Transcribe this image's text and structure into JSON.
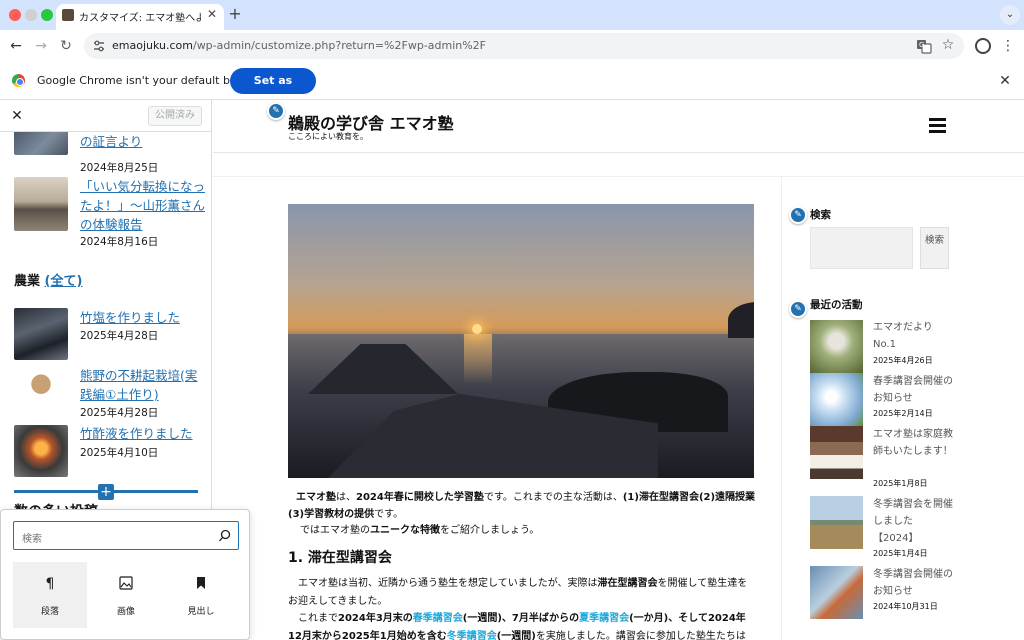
{
  "browser": {
    "tab_title": "カスタマイズ: エマオ塾へようこそ",
    "tab_close": "✕",
    "new_tab": "+",
    "tab_menu": "⌄",
    "url_host": "emaojuku.com",
    "url_path": "/wp-admin/customize.php?return=%2Fwp-admin%2F",
    "nav_back": "←",
    "nav_forward": "→",
    "nav_reload": "↻",
    "star": "☆",
    "kebab": "⋮"
  },
  "infobar": {
    "message": "Google Chrome isn't your default browser",
    "button_label": "Set as default",
    "close": "✕"
  },
  "customizer": {
    "close": "✕",
    "published_label": "公開済み",
    "posts_top": [
      {
        "title": "て！」〜福本航子さんの証言より",
        "title_visible": "て！」〜福本航子さ\nんの証言より",
        "date": "2024年8月25日"
      },
      {
        "title": "「いい気分転換になったよ！」〜山形薫さんの体験報告",
        "date": "2024年8月16日"
      }
    ],
    "category": {
      "name": "農業",
      "all_link": "(全て)"
    },
    "posts_agri": [
      {
        "title": "竹塩を作りました",
        "date": "2025年4月28日"
      },
      {
        "title": "熊野の不耕起栽培(実践編①土作り)",
        "date": "2025年4月28日"
      },
      {
        "title": "竹酢液を作りました",
        "date": "2025年4月10日"
      }
    ],
    "peek_heading": "数の多い投稿",
    "inserter": {
      "search_placeholder": "検索",
      "items": [
        {
          "label": "段落",
          "icon": "paragraph-icon",
          "glyph": "¶"
        },
        {
          "label": "画像",
          "icon": "image-icon",
          "glyph": "▣"
        },
        {
          "label": "見出し",
          "icon": "heading-bookmark-icon",
          "glyph": "■"
        }
      ]
    }
  },
  "site": {
    "title": "鵜殿の学び舎 エマオ塾",
    "tagline": "こころによい教育を。",
    "intro_a": "エマオ塾",
    "intro_b": "は、",
    "intro_c": "2024年春に開校した学習塾",
    "intro_d": "です。これまでの主な活動は、",
    "intro_e": "(1)滞在型講習会(2)遠隔授業(3)学習教材の提供",
    "intro_f": "です。",
    "intro2_a": "ではエマオ塾の",
    "intro2_b": "ユニークな特徴",
    "intro2_c": "をご紹介しましょう。",
    "section_title": "1. 滞在型講習会",
    "body_1": "エマオ塾は当初、近隣から通う塾生を想定していましたが、実際は",
    "body_2": "滞在型講習会",
    "body_3": "を開催して塾生達をお迎えしてきました。",
    "body_4": "これまで",
    "body_5": "2024年3月末の",
    "body_6": "春季講習会",
    "body_7": "(一週間)、7月半ばからの",
    "body_8": "夏季講習会",
    "body_9": "(一か月)、そして",
    "body_10": "2024年12月末から2025年1月始めを含む",
    "body_11": "冬季講習会",
    "body_12": "(一週間)",
    "body_13": "を実施しました。講習会に参加した塾生たちは皆遠方か"
  },
  "widgets": {
    "search_title": "検索",
    "search_button": "検索",
    "recent_title": "最近の活動",
    "recent": [
      {
        "title": "エマオだよりNo.1",
        "date": "2025年4月26日"
      },
      {
        "title": "春季講習会開催のお知らせ",
        "date": "2025年2月14日"
      },
      {
        "title": "エマオ塾は家庭教師もいたします！",
        "date": "2025年1月8日"
      },
      {
        "title": "冬季講習会を開催しました【2024】",
        "date": "2025年1月4日"
      },
      {
        "title": "冬季講習会開催のお知らせ",
        "date": "2024年10月31日"
      }
    ]
  },
  "colors": {
    "accent": "#2271b1",
    "chrome_blue": "#0b57d0",
    "highlight": "#1fa8d8"
  }
}
